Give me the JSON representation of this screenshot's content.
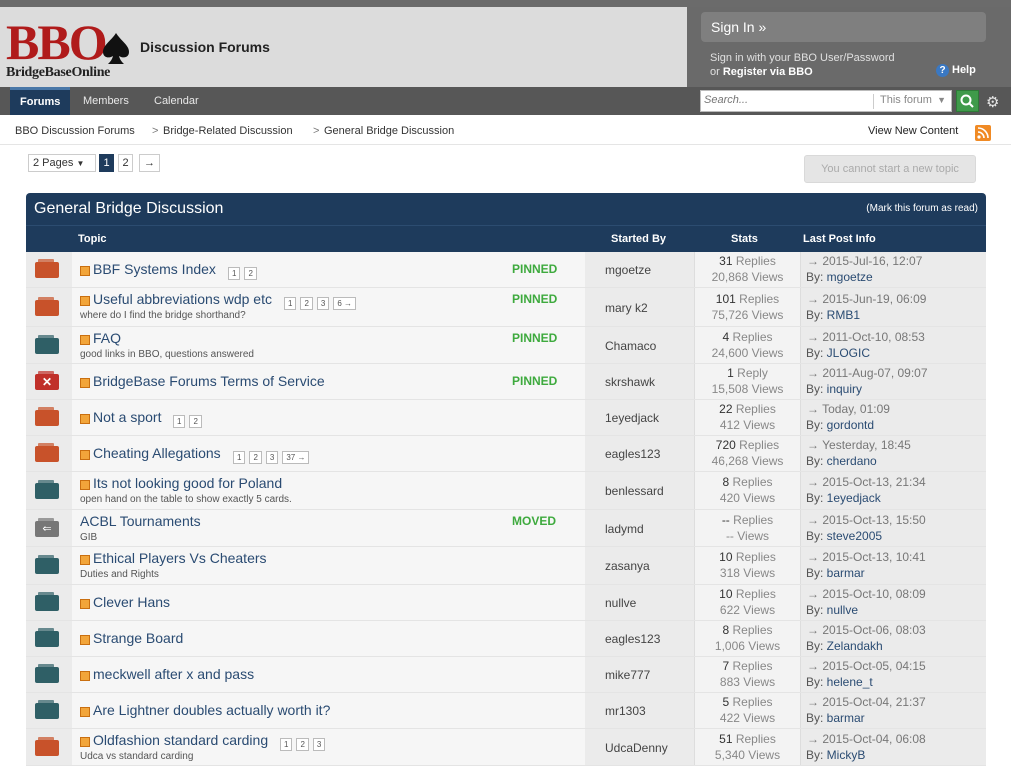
{
  "brand": {
    "logo_main": "BBO",
    "logo_sub": "BridgeBaseOnline",
    "site_title": "Discussion Forums"
  },
  "signin": {
    "button": "Sign In »",
    "line1": "Sign in with your BBO User/Password",
    "or": "or ",
    "register": "Register via BBO",
    "help": "Help"
  },
  "nav": {
    "tabs": [
      "Forums",
      "Members",
      "Calendar"
    ],
    "search_placeholder": "Search...",
    "search_scope": "This forum"
  },
  "breadcrumb": [
    "BBO Discussion Forums",
    "Bridge-Related Discussion",
    "General Bridge Discussion"
  ],
  "view_new": "View New Content",
  "pagination": {
    "dropdown": "2 Pages",
    "pages": [
      "1",
      "2"
    ],
    "next": "→"
  },
  "start_topic": "You cannot start a new topic",
  "forum": {
    "title": "General Bridge Discussion",
    "mark_read": "(Mark this forum as read)",
    "columns": {
      "topic": "Topic",
      "started_by": "Started By",
      "stats": "Stats",
      "last_post": "Last Post Info"
    },
    "rows": [
      {
        "folder": "red",
        "title": "BBF Systems Index",
        "pages": [
          "1",
          "2"
        ],
        "badge": "PINNED",
        "desc": "",
        "starter": "mgoetze",
        "replies": "31",
        "views": "20,868",
        "last_date": "2015-Jul-16, 12:07",
        "last_by": "mgoetze"
      },
      {
        "folder": "red",
        "title": "Useful abbreviations wdp etc",
        "pages": [
          "1",
          "2",
          "3",
          "6 →"
        ],
        "badge": "PINNED",
        "desc": "where do I find the bridge shorthand?",
        "starter": "mary k2",
        "replies": "101",
        "views": "75,726",
        "last_date": "2015-Jun-19, 06:09",
        "last_by": "RMB1"
      },
      {
        "folder": "teal",
        "title": "FAQ",
        "pages": [],
        "badge": "PINNED",
        "desc": "good links in BBO, questions answered",
        "starter": "Chamaco",
        "replies": "4",
        "views": "24,600",
        "last_date": "2011-Oct-10, 08:53",
        "last_by": "JLOGIC"
      },
      {
        "folder": "closed",
        "title": "BridgeBase Forums Terms of Service",
        "pages": [],
        "badge": "PINNED",
        "desc": "",
        "starter": "skrshawk",
        "replies": "1",
        "views": "15,508",
        "replies_label": "Reply",
        "last_date": "2011-Aug-07, 09:07",
        "last_by": "inquiry"
      },
      {
        "folder": "red",
        "title": "Not a sport",
        "pages": [
          "1",
          "2"
        ],
        "badge": "",
        "desc": "",
        "starter": "1eyedjack",
        "replies": "22",
        "views": "412",
        "last_date": "Today, 01:09",
        "last_by": "gordontd"
      },
      {
        "folder": "red",
        "title": "Cheating Allegations",
        "pages": [
          "1",
          "2",
          "3",
          "37 →"
        ],
        "badge": "",
        "desc": "",
        "starter": "eagles123",
        "replies": "720",
        "views": "46,268",
        "last_date": "Yesterday, 18:45",
        "last_by": "cherdano"
      },
      {
        "folder": "teal",
        "title": "Its not looking good for Poland",
        "pages": [],
        "badge": "",
        "desc": "open hand on the table to show exactly 5 cards.",
        "starter": "benlessard",
        "replies": "8",
        "views": "420",
        "last_date": "2015-Oct-13, 21:34",
        "last_by": "1eyedjack"
      },
      {
        "folder": "moved",
        "title": "ACBL Tournaments",
        "pages": [],
        "badge": "MOVED",
        "desc": "GIB",
        "starter": "ladymd",
        "replies": "--",
        "views": "--",
        "last_date": "2015-Oct-13, 15:50",
        "last_by": "steve2005"
      },
      {
        "folder": "teal",
        "title": "Ethical Players Vs Cheaters",
        "pages": [],
        "badge": "",
        "desc": "Duties and Rights",
        "starter": "zasanya",
        "replies": "10",
        "views": "318",
        "last_date": "2015-Oct-13, 10:41",
        "last_by": "barmar"
      },
      {
        "folder": "teal",
        "title": "Clever Hans",
        "pages": [],
        "badge": "",
        "desc": "",
        "starter": "nullve",
        "replies": "10",
        "views": "622",
        "last_date": "2015-Oct-10, 08:09",
        "last_by": "nullve"
      },
      {
        "folder": "teal",
        "title": "Strange Board",
        "pages": [],
        "badge": "",
        "desc": "",
        "starter": "eagles123",
        "replies": "8",
        "views": "1,006",
        "last_date": "2015-Oct-06, 08:03",
        "last_by": "Zelandakh"
      },
      {
        "folder": "teal",
        "title": "meckwell after x and pass",
        "pages": [],
        "badge": "",
        "desc": "",
        "starter": "mike777",
        "replies": "7",
        "views": "883",
        "last_date": "2015-Oct-05, 04:15",
        "last_by": "helene_t"
      },
      {
        "folder": "teal",
        "title": "Are Lightner doubles actually worth it?",
        "pages": [],
        "badge": "",
        "desc": "",
        "starter": "mr1303",
        "replies": "5",
        "views": "422",
        "last_date": "2015-Oct-04, 21:37",
        "last_by": "barmar"
      },
      {
        "folder": "red",
        "title": "Oldfashion standard carding",
        "pages": [
          "1",
          "2",
          "3"
        ],
        "badge": "",
        "desc": "Udca vs standard carding",
        "starter": "UdcaDenny",
        "replies": "51",
        "views": "5,340",
        "last_date": "2015-Oct-04, 06:08",
        "last_by": "MickyB"
      }
    ]
  },
  "labels": {
    "replies": "Replies",
    "views": "Views",
    "by": "By: ",
    "arrow": "→"
  },
  "colors": {
    "nav_dark": "#1e3b5c",
    "pinned_green": "#3eaa3e",
    "logo_red": "#b01b1b"
  }
}
